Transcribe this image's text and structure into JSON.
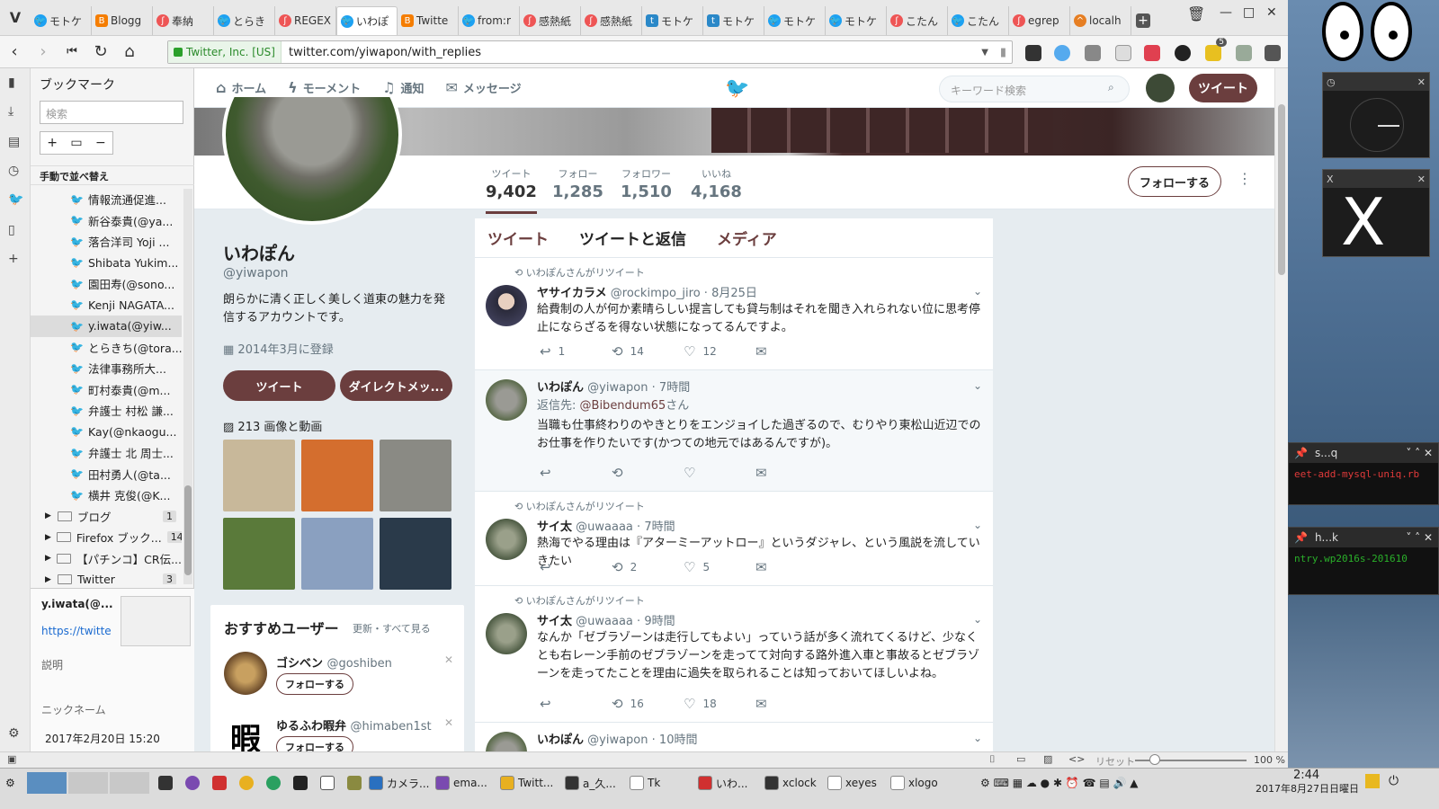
{
  "browser": {
    "tabs": [
      {
        "label": "モトケ",
        "icon": "twitter"
      },
      {
        "label": "Blogg",
        "icon": "blogger"
      },
      {
        "label": "奉納",
        "icon": "firefox"
      },
      {
        "label": "とらき",
        "icon": "twitter"
      },
      {
        "label": "REGEX",
        "icon": "regex"
      },
      {
        "label": "いわぽ",
        "icon": "twitter",
        "active": true
      },
      {
        "label": "Twitte",
        "icon": "blogger"
      },
      {
        "label": "from:r",
        "icon": "twitter"
      },
      {
        "label": "感熱紙",
        "icon": "firefox"
      },
      {
        "label": "感熱紙",
        "icon": "firefox"
      },
      {
        "label": "モトケ",
        "icon": "tt"
      },
      {
        "label": "モトケ",
        "icon": "tt"
      },
      {
        "label": "モトケ",
        "icon": "twitter"
      },
      {
        "label": "モトケ",
        "icon": "twitter"
      },
      {
        "label": "こたん",
        "icon": "firefox"
      },
      {
        "label": "こたん",
        "icon": "twitter"
      },
      {
        "label": "egrep",
        "icon": "firefox"
      },
      {
        "label": "localh",
        "icon": "localhost"
      }
    ],
    "identity": "Twitter, Inc. [US]",
    "url": "twitter.com/yiwapon/with_replies",
    "menu_letter": "V",
    "extension_badge": "5"
  },
  "sidebar": {
    "title": "ブックマーク",
    "search_placeholder": "検索",
    "sort_label": "手動で並べ替え",
    "bookmarks": [
      {
        "label": "情報流通促進..."
      },
      {
        "label": "新谷泰貴(@ya..."
      },
      {
        "label": "落合洋司 Yoji ..."
      },
      {
        "label": "Shibata Yukim..."
      },
      {
        "label": "園田寿(@sono..."
      },
      {
        "label": "Kenji NAGATA..."
      },
      {
        "label": "y.iwata(@yiw...",
        "selected": true
      },
      {
        "label": "とらきち(@tora..."
      },
      {
        "label": "法律事務所大..."
      },
      {
        "label": "町村泰貴(@m..."
      },
      {
        "label": "弁護士 村松 謙..."
      },
      {
        "label": "Kay(@nkaogu..."
      },
      {
        "label": "弁護士 北 周士..."
      },
      {
        "label": "田村勇人(@ta..."
      },
      {
        "label": "横井 克俊(@K..."
      }
    ],
    "folders": [
      {
        "label": "ブログ",
        "count": "1"
      },
      {
        "label": "Firefox ブック...",
        "count": "14"
      },
      {
        "label": "【パチンコ】CR伝..."
      },
      {
        "label": "Twitter",
        "count": "3"
      }
    ],
    "props": {
      "name": "y.iwata(@...",
      "url": "https://twitte",
      "description_label": "説明",
      "nickname_label": "ニックネーム",
      "date": "2017年2月20日 15:20"
    }
  },
  "twitter": {
    "nav": [
      "ホーム",
      "モーメント",
      "通知",
      "メッセージ"
    ],
    "search_placeholder": "キーワード検索",
    "tweet_button": "ツイート",
    "stats": [
      {
        "label": "ツイート",
        "value": "9,402"
      },
      {
        "label": "フォロー",
        "value": "1,285"
      },
      {
        "label": "フォロワー",
        "value": "1,510"
      },
      {
        "label": "いいね",
        "value": "4,168"
      }
    ],
    "follow_button": "フォローする",
    "profile": {
      "name": "いわぽん",
      "handle": "@yiwapon",
      "bio": "朗らかに清く正しく美しく道東の魅力を発信するアカウントです。",
      "joined": "2014年3月に登録",
      "tweet_btn": "ツイート",
      "dm_btn": "ダイレクトメッ...",
      "media": "213 画像と動画",
      "media_thumbs": [
        {
          "color": "#c8b89a"
        },
        {
          "color": "#d46e2e"
        },
        {
          "color": "#8a8a84"
        },
        {
          "color": "#5a7a3a"
        },
        {
          "color": "#8aa0c0"
        },
        {
          "color": "#2a3a4a"
        }
      ]
    },
    "suggestions": {
      "title": "おすすめユーザー",
      "links": "更新・すべて見る",
      "users": [
        {
          "name": "ゴシベン",
          "handle": "@goshiben",
          "follow": "フォローする"
        },
        {
          "name": "ゆるふわ暇弁",
          "handle": "@himaben1st",
          "follow": "フォローする"
        }
      ]
    },
    "timeline_tabs": [
      "ツイート",
      "ツイートと返信",
      "メディア"
    ],
    "tweets": [
      {
        "retweet_by": "いわぽんさんがリツイート",
        "name": "ヤサイカラメ",
        "handle": "@rockimpo_jiro",
        "time": "8月25日",
        "text": "給費制の人が何か素晴らしい提言しても貸与制はそれを聞き入れられない位に思考停止にならざるを得ない状態になってるんですよ。",
        "replies": "1",
        "retweets": "14",
        "likes": "12"
      },
      {
        "name": "いわぽん",
        "handle": "@yiwapon",
        "time": "7時間",
        "reply_label": "返信先:",
        "reply_to": "@Bibendum65",
        "reply_suffix": "さん",
        "text": "当職も仕事終わりのやきとりをエンジョイした過ぎるので、むりやり東松山近辺でのお仕事を作りたいです(かつての地元ではあるんですが)。",
        "replies": "",
        "retweets": "",
        "likes": ""
      },
      {
        "retweet_by": "いわぽんさんがリツイート",
        "name": "サイ太",
        "handle": "@uwaaaa",
        "time": "7時間",
        "text": "熱海でやる理由は『アターミーアットロー』というダジャレ、という風説を流していきたい",
        "replies": "",
        "retweets": "2",
        "likes": "5"
      },
      {
        "retweet_by": "いわぽんさんがリツイート",
        "name": "サイ太",
        "handle": "@uwaaaa",
        "time": "9時間",
        "text": "なんか「ゼブラゾーンは走行してもよい」っていう話が多く流れてくるけど、少なくとも右レーン手前のゼブラゾーンを走ってて対向する路外進入車と事故るとゼブラゾーンを走ってたことを理由に過失を取られることは知っておいてほしいよね。",
        "replies": "",
        "retweets": "16",
        "likes": "18"
      },
      {
        "name": "いわぽん",
        "handle": "@yiwapon",
        "time": "10時間",
        "text": ""
      }
    ]
  },
  "statusline": {
    "reset": "リセット",
    "zoom": "100 %"
  },
  "taskbar": {
    "items": [
      "カメラ...",
      "ema...",
      "Twitt...",
      "a_久...",
      "Tk",
      "いわ...",
      "xclock",
      "xeyes",
      "xlogo"
    ],
    "time": "2:44",
    "date": "2017年8月27日日曜日"
  },
  "desktop": {
    "terminals": [
      {
        "title": "s...q",
        "text": "eet-add-mysql-uniq.rb"
      },
      {
        "title": "h...k",
        "text": "ntry.wp2016s-201610"
      }
    ]
  }
}
